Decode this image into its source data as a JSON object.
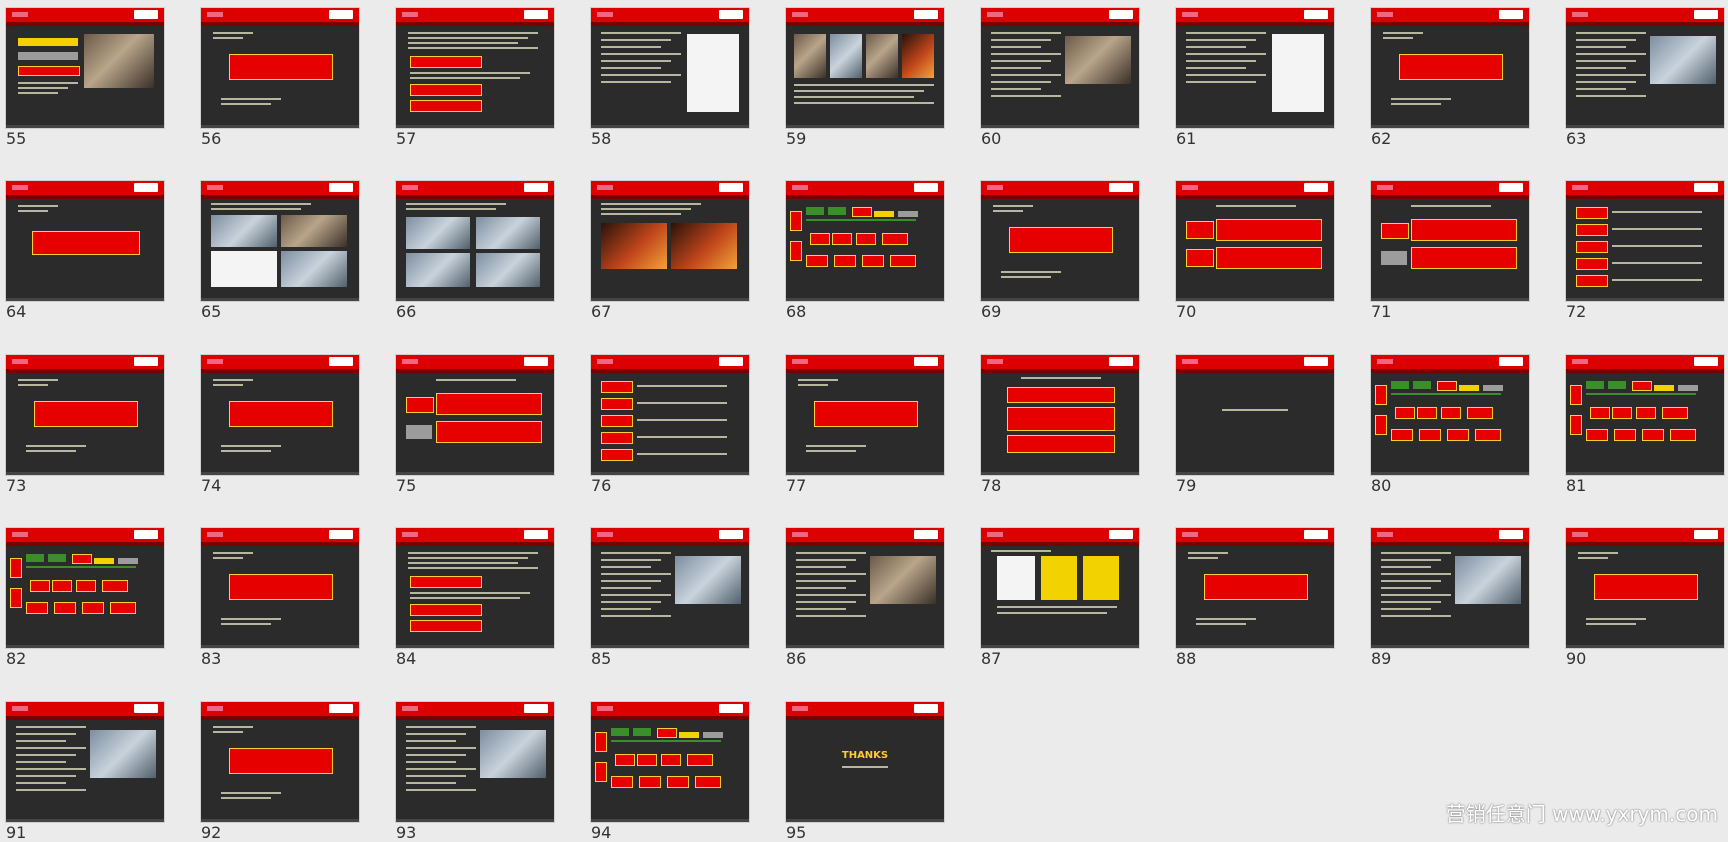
{
  "slides": [
    {
      "number": "55",
      "layout": "list-photo"
    },
    {
      "number": "56",
      "layout": "center-red"
    },
    {
      "number": "57",
      "layout": "text-boxes"
    },
    {
      "number": "58",
      "layout": "text-white"
    },
    {
      "number": "59",
      "layout": "four-photos"
    },
    {
      "number": "60",
      "layout": "text-photo"
    },
    {
      "number": "61",
      "layout": "text-white"
    },
    {
      "number": "62",
      "layout": "center-red"
    },
    {
      "number": "63",
      "layout": "text-photo"
    },
    {
      "number": "64",
      "layout": "center-red-small"
    },
    {
      "number": "65",
      "layout": "photo-grid"
    },
    {
      "number": "66",
      "layout": "photo-grid2"
    },
    {
      "number": "67",
      "layout": "photo-wide"
    },
    {
      "number": "68",
      "layout": "flow-chart"
    },
    {
      "number": "69",
      "layout": "center-red"
    },
    {
      "number": "70",
      "layout": "two-rows"
    },
    {
      "number": "71",
      "layout": "two-rows-gray"
    },
    {
      "number": "72",
      "layout": "list-boxes"
    },
    {
      "number": "73",
      "layout": "center-red"
    },
    {
      "number": "74",
      "layout": "center-red"
    },
    {
      "number": "75",
      "layout": "two-rows-gray"
    },
    {
      "number": "76",
      "layout": "list-boxes"
    },
    {
      "number": "77",
      "layout": "center-red"
    },
    {
      "number": "78",
      "layout": "stack-three"
    },
    {
      "number": "79",
      "layout": "blank-title"
    },
    {
      "number": "80",
      "layout": "flow-chart"
    },
    {
      "number": "81",
      "layout": "flow-chart"
    },
    {
      "number": "82",
      "layout": "flow-chart"
    },
    {
      "number": "83",
      "layout": "center-red"
    },
    {
      "number": "84",
      "layout": "text-boxes"
    },
    {
      "number": "85",
      "layout": "text-photo"
    },
    {
      "number": "86",
      "layout": "text-photo"
    },
    {
      "number": "87",
      "layout": "three-icons"
    },
    {
      "number": "88",
      "layout": "center-red"
    },
    {
      "number": "89",
      "layout": "text-photo"
    },
    {
      "number": "90",
      "layout": "center-red"
    },
    {
      "number": "91",
      "layout": "text-photo"
    },
    {
      "number": "92",
      "layout": "center-red"
    },
    {
      "number": "93",
      "layout": "text-photo"
    },
    {
      "number": "94",
      "layout": "flow-chart"
    },
    {
      "number": "95",
      "layout": "thanks"
    }
  ],
  "thanks_slide": {
    "title": "THANKS"
  },
  "watermark": "营销任意门 www.yxrym.com",
  "colors": {
    "page_bg": "#ebebeb",
    "slide_bg": "#2b2b2b",
    "header_red": "#dd0000",
    "accent_yellow": "#ffcc33"
  }
}
